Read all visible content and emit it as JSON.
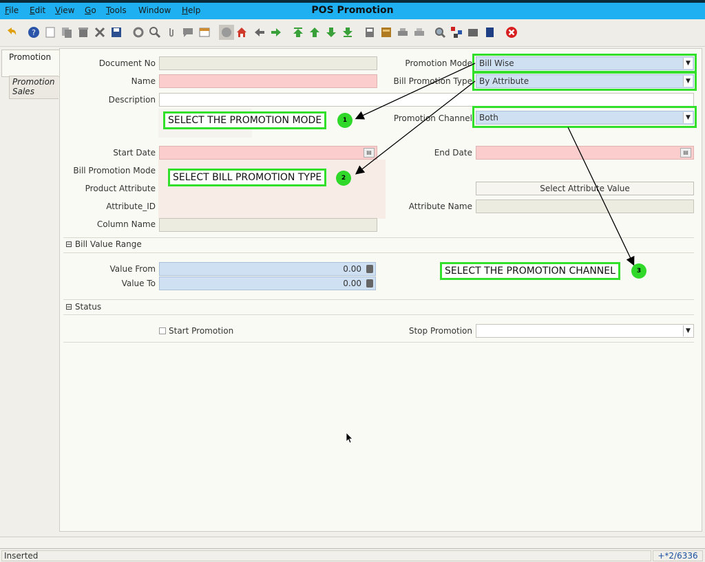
{
  "window": {
    "title": "POS Promotion"
  },
  "menu": [
    {
      "label": "File",
      "underline": "F",
      "rest": "ile"
    },
    {
      "label": "Edit",
      "underline": "E",
      "rest": "dit"
    },
    {
      "label": "View",
      "underline": "V",
      "rest": "iew"
    },
    {
      "label": "Go",
      "underline": "G",
      "rest": "o"
    },
    {
      "label": "Tools",
      "underline": "T",
      "rest": "ools"
    },
    {
      "label": "Window",
      "underline": "",
      "rest": "Window"
    },
    {
      "label": "Help",
      "underline": "H",
      "rest": "elp"
    }
  ],
  "tabs": {
    "active": "Promotion",
    "second_line1": "Promotion",
    "second_line2": "Sales"
  },
  "form": {
    "document_no_label": "Document No",
    "name_label": "Name",
    "description_label": "Description",
    "start_date_label": "Start Date",
    "end_date_label": "End Date",
    "bill_promotion_mode_label": "Bill Promotion Mode",
    "product_attribute_label": "Product Attribute",
    "attribute_id_label": "Attribute_ID",
    "attribute_name_label": "Attribute Name",
    "column_name_label": "Column Name",
    "promotion_mode_label": "Promotion Mode",
    "promotion_mode_value": "Bill Wise",
    "bill_promotion_type_label": "Bill Promotion Type",
    "bill_promotion_type_value": "By Attribute",
    "promotion_channel_label": "Promotion Channel",
    "promotion_channel_value": "Both",
    "select_attribute_button": "Select Attribute Value"
  },
  "bill_value_range": {
    "header": "Bill Value Range",
    "value_from_label": "Value From",
    "value_from": "0.00",
    "value_to_label": "Value To",
    "value_to": "0.00"
  },
  "status_section": {
    "header": "Status",
    "start_promotion_label": "Start Promotion",
    "stop_promotion_label": "Stop Promotion"
  },
  "callouts": {
    "c1_text": "SELECT THE PROMOTION MODE",
    "c1_num": "1",
    "c2_text": "SELECT BILL PROMOTION TYPE",
    "c2_num": "2",
    "c3_text": "SELECT THE PROMOTION CHANNEL",
    "c3_num": "3"
  },
  "statusbar": {
    "message": "Inserted",
    "record": "+*2/6336"
  },
  "colors": {
    "menubar": "#1eb0f0",
    "mandatory": "#fbcdcd",
    "combo": "#cfe0f2",
    "highlight": "#32e02c"
  }
}
